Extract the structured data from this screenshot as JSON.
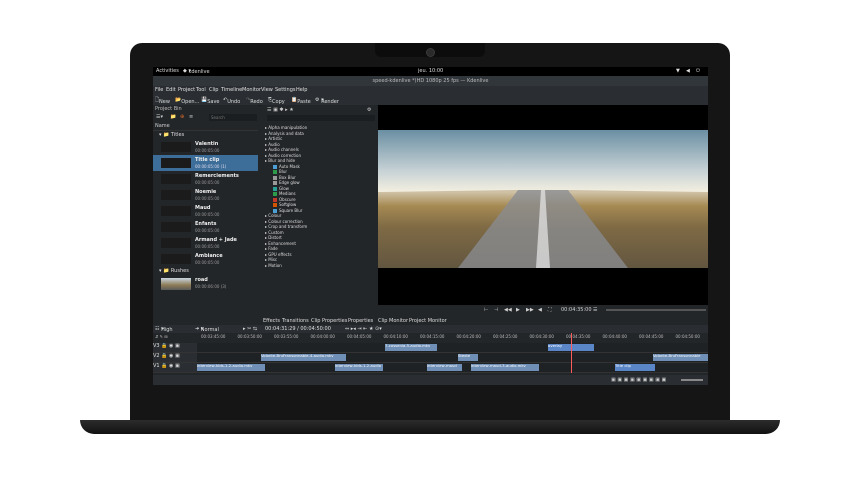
{
  "topbar": {
    "activities": "Activities",
    "app": "kdenlive",
    "time": "jeu. 10:00"
  },
  "titlebar": {
    "title": "speed-kdenlive *(HD 1080p 25 fps — Kdenlive"
  },
  "menu": [
    "File",
    "Edit",
    "Project",
    "Tool",
    "Clip",
    "Timeline",
    "Monitor",
    "View",
    "Settings",
    "Help"
  ],
  "toolbar": [
    "New",
    "Open...",
    "Save",
    "Undo",
    "Redo",
    "Copy",
    "Paste",
    "Render"
  ],
  "bin": {
    "header": "Project Bin",
    "search_placeholder": "Search",
    "column": "Name",
    "folder_titles": "Titles",
    "folder_rushes": "Rushes",
    "clips": [
      {
        "name": "Valentin",
        "dur": "00:00:05:00"
      },
      {
        "name": "Title clip",
        "dur": "00:00:05:00 (1)"
      },
      {
        "name": "Remerciements",
        "dur": "00:00:05:00"
      },
      {
        "name": "Noemie",
        "dur": "00:00:05:00"
      },
      {
        "name": "Maud",
        "dur": "00:00:05:00"
      },
      {
        "name": "Enfants",
        "dur": "00:00:05:00"
      },
      {
        "name": "Armand + Jade",
        "dur": "00:00:05:00"
      },
      {
        "name": "Ambiance",
        "dur": "00:00:05:00"
      }
    ],
    "rush": {
      "name": "road",
      "dur": "00:00:06:00 (3)"
    }
  },
  "effects": [
    {
      "label": "Alpha manipulation",
      "sub": false,
      "color": ""
    },
    {
      "label": "Analysis and data",
      "sub": false,
      "color": ""
    },
    {
      "label": "Artistic",
      "sub": false,
      "color": ""
    },
    {
      "label": "Audio",
      "sub": false,
      "color": ""
    },
    {
      "label": "Audio channels",
      "sub": false,
      "color": ""
    },
    {
      "label": "Audio correction",
      "sub": false,
      "color": ""
    },
    {
      "label": "Blur and hide",
      "sub": false,
      "color": ""
    },
    {
      "label": "Auto Mask",
      "sub": true,
      "color": "#4b9fd5"
    },
    {
      "label": "Blur",
      "sub": true,
      "color": "#2c9c4b"
    },
    {
      "label": "Box Blur",
      "sub": true,
      "color": "#999999"
    },
    {
      "label": "Edge glow",
      "sub": true,
      "color": "#999999"
    },
    {
      "label": "Glow",
      "sub": true,
      "color": "#2aa198"
    },
    {
      "label": "Medians",
      "sub": true,
      "color": "#2c9c4b"
    },
    {
      "label": "Obscure",
      "sub": true,
      "color": "#c0392b"
    },
    {
      "label": "Softglow",
      "sub": true,
      "color": "#d35400"
    },
    {
      "label": "Square Blur",
      "sub": true,
      "color": "#4b9fd5"
    },
    {
      "label": "Colour",
      "sub": false,
      "color": ""
    },
    {
      "label": "Colour correction",
      "sub": false,
      "color": ""
    },
    {
      "label": "Crop and transform",
      "sub": false,
      "color": ""
    },
    {
      "label": "Custom",
      "sub": false,
      "color": ""
    },
    {
      "label": "Distort",
      "sub": false,
      "color": ""
    },
    {
      "label": "Enhancement",
      "sub": false,
      "color": ""
    },
    {
      "label": "Fade",
      "sub": false,
      "color": ""
    },
    {
      "label": "GPU effects",
      "sub": false,
      "color": ""
    },
    {
      "label": "Misc",
      "sub": false,
      "color": ""
    },
    {
      "label": "Motion",
      "sub": false,
      "color": ""
    }
  ],
  "monitor": {
    "timecode": "00:04:35:00"
  },
  "tabs": [
    "Effects",
    "Transitions",
    "Clip Properties",
    "Properties",
    "Clip Monitor",
    "Project Monitor"
  ],
  "timeline": {
    "quality": "High Quality",
    "mode": "Normal mode",
    "position": "00:04:31:29 / 00:04:50:00",
    "ruler": [
      "00:03:45:00",
      "00:03:50:00",
      "00:03:55:00",
      "00:04:00:00",
      "00:04:05:00",
      "00:04:10:00",
      "00:04:15:00",
      "00:04:20:00",
      "00:04:25:00",
      "00:04:30:00",
      "00:04:35:00",
      "00:04:40:00",
      "00:04:45:00",
      "00:04:50:00"
    ],
    "tracks": [
      {
        "name": "V3",
        "clips": [
          {
            "label": "7-cossenia-5-audio.mkv",
            "color": "#6f8fb6"
          },
          {
            "label": "overlay",
            "color": "#5a86c8"
          }
        ]
      },
      {
        "name": "V2",
        "clips": [
          {
            "label": "Volonte-BruFransonnable-4-audio.mkv",
            "color": "#6f8fb6"
          },
          {
            "label": "Stexte",
            "color": "#6f8fb6"
          },
          {
            "label": "Volonte-BruFransonnable",
            "color": "#6f8fb6"
          }
        ]
      },
      {
        "name": "V1",
        "clips": [
          {
            "label": "interview-kids-1-2-audio.mkv",
            "color": "#6f8fb6"
          },
          {
            "label": "interview-kids-1-2-audio",
            "color": "#6f8fb6"
          },
          {
            "label": "interview-maud",
            "color": "#6f8fb6"
          },
          {
            "label": "interview-maud-3-audio.mkv",
            "color": "#6f8fb6"
          },
          {
            "label": "Title clip",
            "color": "#5a86c8"
          }
        ]
      }
    ]
  }
}
